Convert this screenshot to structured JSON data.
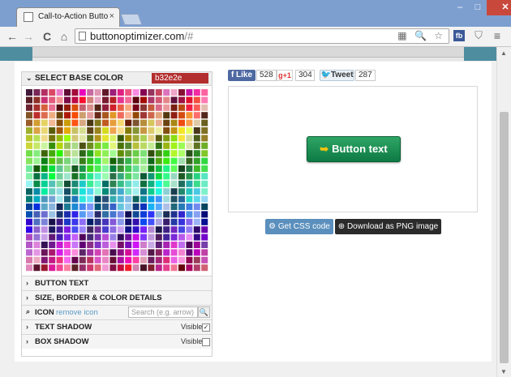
{
  "browser": {
    "tab_title": "Call-to-Action Button Ge",
    "tab_close": "×",
    "url_host": "buttonoptimizer.com",
    "url_rest": "/#",
    "nav_back": "←",
    "nav_forward": "→",
    "nav_reload": "C",
    "nav_home": "⌂",
    "omni_icons": "▦ 🔍 ☆",
    "ext_fb": "fb",
    "ext_shield": "⛉",
    "menu": "≡",
    "win_min": "–",
    "win_max": "□",
    "win_close": "✕"
  },
  "panel": {
    "header_chevron": "⌄",
    "header_label": "SELECT BASE COLOR",
    "hex_value": "b32e2e",
    "sections": [
      {
        "label": "BUTTON TEXT"
      },
      {
        "label": "SIZE, BORDER & COLOR DETAILS"
      },
      {
        "label": "ICON",
        "link": "remove icon",
        "search_placeholder": "Search (e.g. arrow)",
        "search_icon": "🔍"
      },
      {
        "label": "TEXT SHADOW",
        "visible_label": "Visible",
        "checked": "✓"
      },
      {
        "label": "BOX SHADOW",
        "visible_label": "Visible",
        "checked": ""
      }
    ]
  },
  "social": {
    "fb_label": "f Like",
    "fb_count": "528",
    "gplus_label": "g+1",
    "gplus_count": "304",
    "tweet_label": "Tweet",
    "tweet_bird": "🐦",
    "tweet_count": "287"
  },
  "preview": {
    "cta_icon": "➥",
    "cta_label": "Button text",
    "cta_color": "#1a8c52"
  },
  "actions": {
    "css_label": "Get CSS code",
    "css_icon": "⚙",
    "png_label": "Download as PNG image",
    "png_icon": "⊕"
  }
}
